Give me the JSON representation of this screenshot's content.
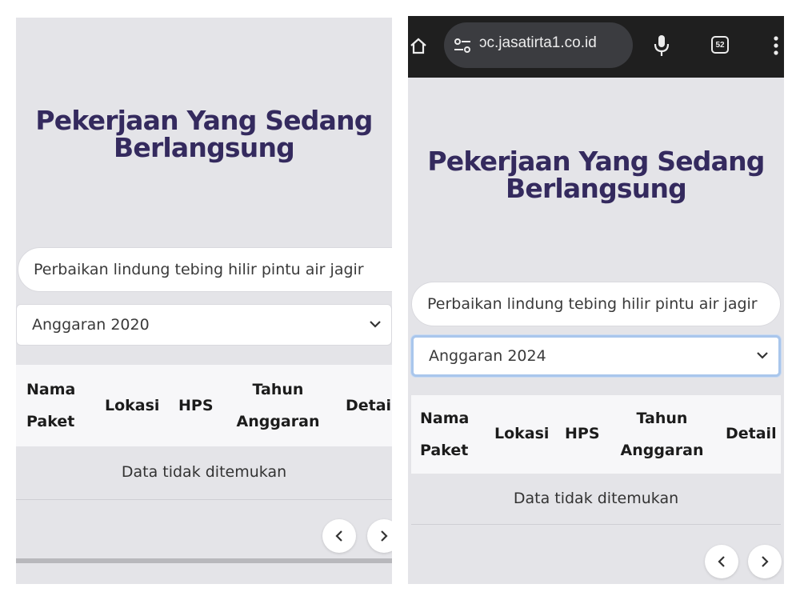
{
  "panels": {
    "left": {
      "title_line1": "Pekerjaan Yang Sedang",
      "title_line2": "Berlangsung",
      "search_value": "Perbaikan lindung tebing hilir pintu air jagir",
      "select_value": "Anggaran 2020",
      "table": {
        "headers": {
          "nama_line1": "Nama",
          "nama_line2": "Paket",
          "lokasi": "Lokasi",
          "hps": "HPS",
          "tahun_line1": "Tahun",
          "tahun_line2": "Anggaran",
          "detail": "Detail"
        },
        "empty_message": "Data tidak ditemukan"
      },
      "pagination": {
        "prev": "<",
        "next": ">"
      }
    },
    "right": {
      "browser": {
        "url": "ɔc.jasatirta1.co.id",
        "tab_count": "52"
      },
      "title_line1": "Pekerjaan Yang Sedang",
      "title_line2": "Berlangsung",
      "search_value": "Perbaikan lindung tebing hilir pintu air jagir",
      "select_value": "Anggaran 2024",
      "table": {
        "headers": {
          "nama_line1": "Nama",
          "nama_line2": "Paket",
          "lokasi": "Lokasi",
          "hps": "HPS",
          "tahun_line1": "Tahun",
          "tahun_line2": "Anggaran",
          "detail": "Detail"
        },
        "empty_message": "Data tidak ditemukan"
      },
      "pagination": {
        "prev": "<",
        "next": ">"
      }
    }
  },
  "colors": {
    "panel_bg": "#e4e4e8",
    "title": "#342a5e",
    "browser_bar": "#1f1f1f",
    "focus_ring": "#a9c6ec"
  },
  "icons": [
    "home-icon",
    "tune-icon",
    "mic-icon",
    "tabs-icon",
    "more-vert-icon",
    "chevron-down-icon",
    "chevron-left-icon",
    "chevron-right-icon"
  ]
}
